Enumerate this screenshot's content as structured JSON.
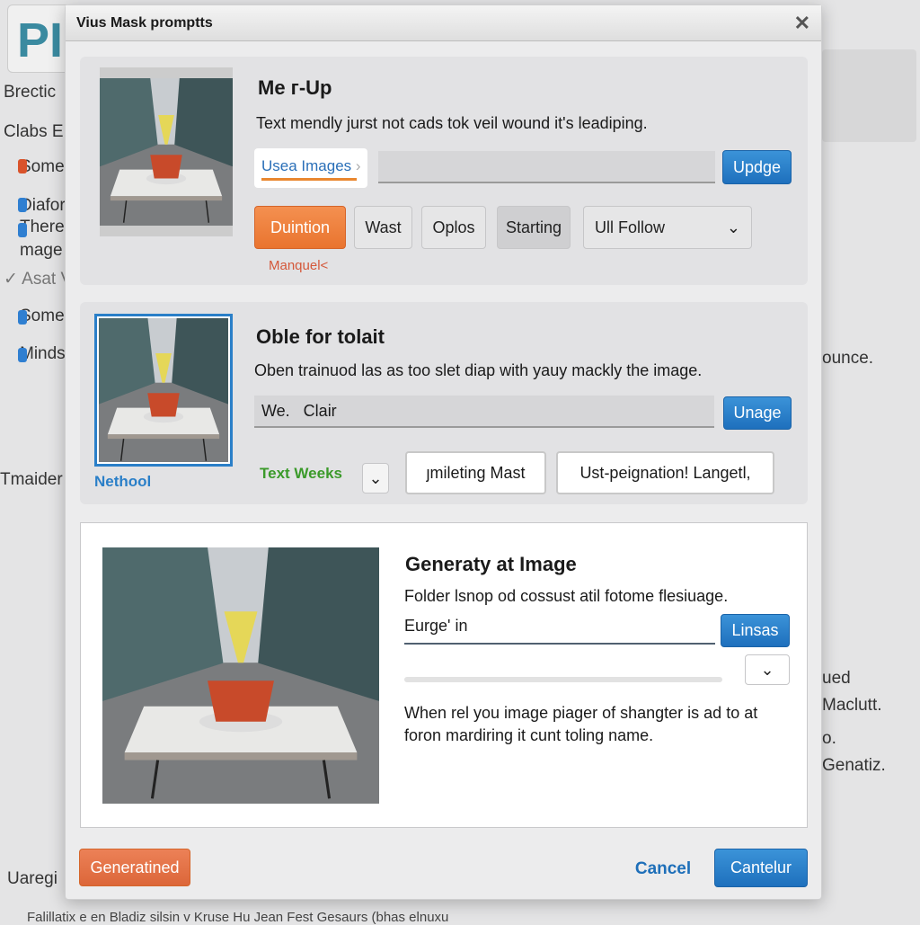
{
  "background": {
    "logo": "PI",
    "left_items": [
      "Brectic",
      "Clabs E",
      "Some",
      "Diafor",
      "There",
      "mage",
      "Asat V",
      "Some",
      "Minds",
      "Tmaider",
      "Uaregi"
    ],
    "right_items": [
      "ounce.",
      "ued",
      "Maclutt.",
      "o.",
      "Genatiz."
    ],
    "bottom_text": "Falillatix e en Bladiz silsin v Kruse Hu Jean Fest Gesaurs (bhas elnuxu"
  },
  "dialog": {
    "title": "Vius Mask promptts",
    "section1": {
      "heading": "Me г-Up",
      "description": "Text mendly jurst not cads tok veil wound it's leadiping.",
      "tab_label": "Usea Images",
      "input_value": "",
      "button": "Updge",
      "options": [
        "Duintion",
        "Wast",
        "Oplos",
        "Starting"
      ],
      "select_value": "Ull Follow",
      "caption": "Manquel<"
    },
    "section2": {
      "heading": "Oble for tolait",
      "description": "Oben trainuod las as too slet diap with yauy mackly the image.",
      "input_value": "We.   Clair",
      "button": "Unage",
      "thumb_caption": "Nethool",
      "green_label": "Text Weeks",
      "field1": "ȷmileting Mast",
      "field2": "Ust-peignation! Langetl,"
    },
    "section3": {
      "heading": "Generaty at Image",
      "description": "Folder lsnop od cossust atil fotome flesiuage.",
      "input_value": "Eurge' in",
      "button": "Linsas",
      "body": [
        "When rel you image piager of shangter is ad to at",
        "foron mardiring it cunt toling name."
      ]
    },
    "footer": {
      "generate": "Generatined",
      "cancel": "Cancel",
      "confirm": "Cantelur"
    }
  },
  "colors": {
    "accent_blue": "#1e70bd",
    "accent_orange": "#e9742f",
    "green": "#3b9a2a"
  }
}
